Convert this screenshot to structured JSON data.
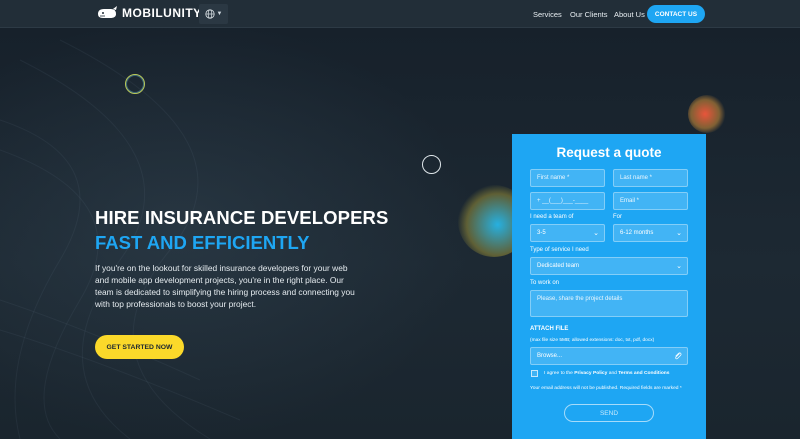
{
  "header": {
    "logo_text": "MOBILUNITY",
    "nav": [
      "Services",
      "Our Clients",
      "About Us"
    ],
    "contact_label": "CONTACT US"
  },
  "hero": {
    "title_line1": "HIRE INSURANCE DEVELOPERS",
    "title_line2": "FAST AND EFFICIENTLY",
    "description": "If you're on the lookout for skilled insurance developers for your web and mobile app development projects, you're in the right place. Our team is dedicated to simplifying the hiring process and connecting you with top professionals to boost your project.",
    "cta_label": "GET STARTED NOW"
  },
  "form": {
    "title": "Request a quote",
    "first_name_placeholder": "First name *",
    "last_name_placeholder": "Last name *",
    "phone_placeholder": "+ __(___)___-____",
    "email_placeholder": "Email *",
    "team_label": "I need a team of",
    "team_value": "3-5",
    "for_label": "For",
    "for_value": "6-12 months",
    "service_label": "Type of service I need",
    "service_value": "Dedicated team",
    "work_label": "To work on",
    "work_placeholder": "Please, share the project details",
    "attach_title": "ATTACH FILE",
    "attach_note": "(max file size 5MB; allowed extensions: doc, txt, pdf, docx)",
    "browse_placeholder": "Browse...",
    "agree_prefix": "I agree to the ",
    "privacy_policy": "Privacy Policy",
    "agree_and": " and ",
    "terms": "Terms and Conditions",
    "privacy_note": "Your email address will not be published. Required fields are marked *",
    "send_label": "SEND"
  },
  "colors": {
    "accent": "#1ea6f3",
    "cta": "#fbd92a",
    "background": "#1b2630"
  }
}
